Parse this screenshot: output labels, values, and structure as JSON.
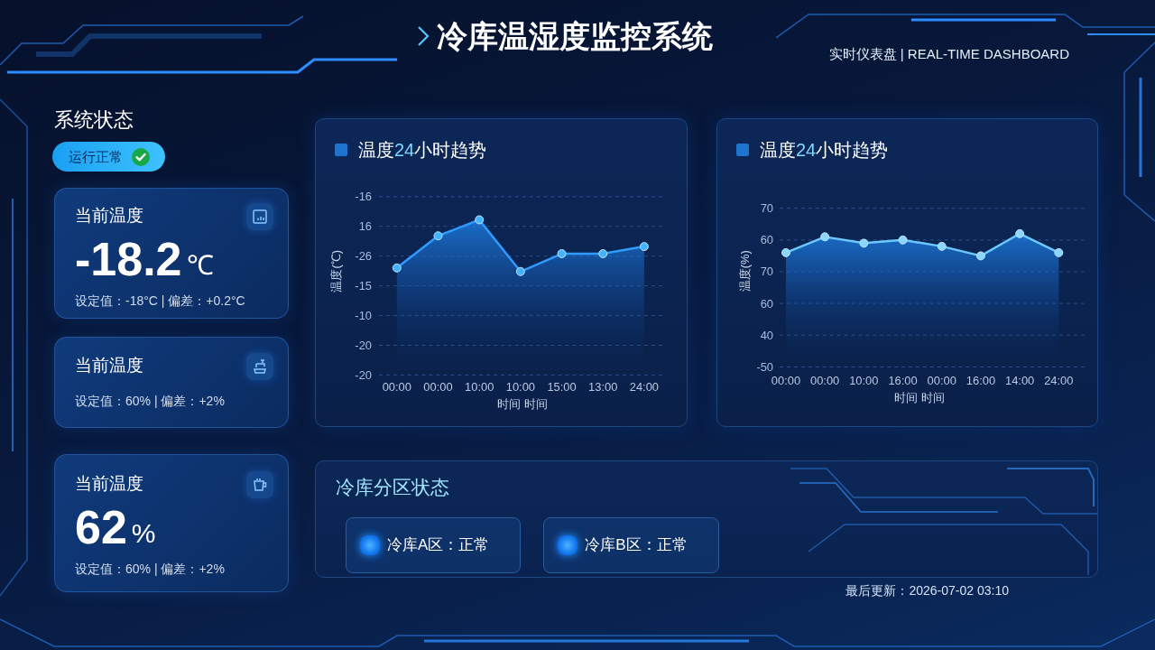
{
  "header": {
    "title": "冷库温湿度监控系统",
    "subtitle": "实时仪表盘 | REAL-TIME DASHBOARD"
  },
  "system_status": {
    "heading": "系统状态",
    "label": "运行正常",
    "ok": true
  },
  "readings": [
    {
      "kind": "value",
      "title": "当前温度",
      "value": "-18.2",
      "unit": "℃",
      "detail": "设定值：-18°C | 偏差：+0.2°C"
    },
    {
      "kind": "compact",
      "title": "当前温度",
      "detail": "设定值：60% | 偏差：+2%"
    },
    {
      "kind": "value",
      "title": "当前温度",
      "value": "62",
      "unit": "%",
      "detail": "设定值：60% | 偏差：+2%"
    }
  ],
  "charts": [
    {
      "title": [
        {
          "text": "温度",
          "highlight": false
        },
        {
          "text": "24",
          "highlight": true
        },
        {
          "text": "小时趋势",
          "highlight": false
        }
      ],
      "y_axis_labels": [
        "-16",
        "16",
        "-26",
        "-15",
        "-10",
        "-20",
        "-20"
      ],
      "x_axis_labels": [
        "00:00",
        "00:00",
        "10:00",
        "10:00",
        "15:00",
        "13:00",
        "24:00"
      ],
      "xlabel": "时间 时间",
      "ylabel": "温度(℃)"
    },
    {
      "title": [
        {
          "text": "温度",
          "highlight": false
        },
        {
          "text": "24",
          "highlight": true
        },
        {
          "text": "小时趋势",
          "highlight": false
        }
      ],
      "y_axis_labels": [
        "70",
        "60",
        "70",
        "60",
        "40",
        "-50"
      ],
      "x_axis_labels": [
        "00:00",
        "00:00",
        "10:00",
        "16:00",
        "00:00",
        "16:00",
        "14:00",
        "24:00"
      ],
      "xlabel": "时间 时间",
      "ylabel": "温度(%)"
    }
  ],
  "zone_panel": {
    "heading": "冷库分区状态",
    "zones": [
      {
        "label": "冷库A区：正常"
      },
      {
        "label": "冷库B区：正常"
      }
    ]
  },
  "last_updated": "最后更新：2026-07-02 03:10"
}
